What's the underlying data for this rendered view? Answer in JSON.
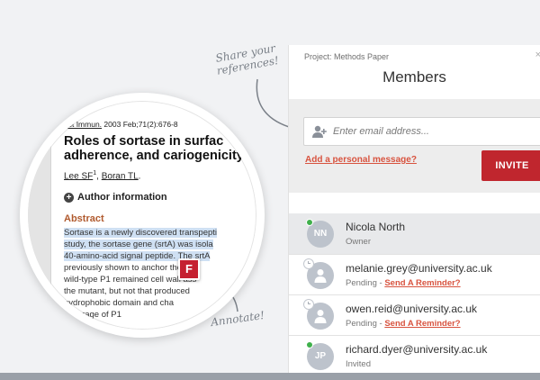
{
  "notes": {
    "share": "Share your references!",
    "annotate": "Annotate!"
  },
  "paper": {
    "citation_journal": "ect Immun.",
    "citation_rest": "2003 Feb;71(2):676-8",
    "title_lines": [
      "Roles of sortase in surfac",
      "adherence, and cariogenicity"
    ],
    "author1": "Lee SF",
    "author1_sup": "1",
    "author_sep": ", ",
    "author2": "Boran TL",
    "author_end": ".",
    "author_info": "Author information",
    "abstract_heading": "Abstract",
    "abstract_lines": [
      "Sortase is a newly discovered transpepti",
      "study, the sortase gene (srtA) was isola",
      "40-amino-acid signal peptide. The srtA",
      "previously shown to anchor the pep",
      "wild-type P1 remained cell wall ass",
      "the mutant, but not that produced",
      "hydrophobic domain and cha",
      "coverage of P1"
    ]
  },
  "annotate_badge": "F",
  "panel": {
    "project_label": "Project: Methods Paper",
    "title": "Members",
    "close": "×",
    "email_placeholder": "Enter email address...",
    "personal_message_link": "Add a personal message?",
    "invite_button": "INVITE"
  },
  "members": [
    {
      "name": "Nicola North",
      "initials": "NN",
      "status": "Owner",
      "online": true,
      "pending": false
    },
    {
      "name": "melanie.grey@university.ac.uk",
      "initials": "",
      "status": "Pending",
      "reminder": "Send A Reminder?",
      "online": false,
      "pending": true
    },
    {
      "name": "owen.reid@university.ac.uk",
      "initials": "",
      "status": "Pending",
      "reminder": "Send A Reminder?",
      "online": false,
      "pending": true
    },
    {
      "name": "richard.dyer@university.ac.uk",
      "initials": "JP",
      "status": "Invited",
      "online": true,
      "pending": false
    }
  ],
  "status_separator": " - ",
  "colors": {
    "accent": "#c0262e",
    "link": "#d8533f",
    "online": "#3fb04b",
    "highlight": "#cfe0f3",
    "abstract_heading": "#b05a2e"
  }
}
